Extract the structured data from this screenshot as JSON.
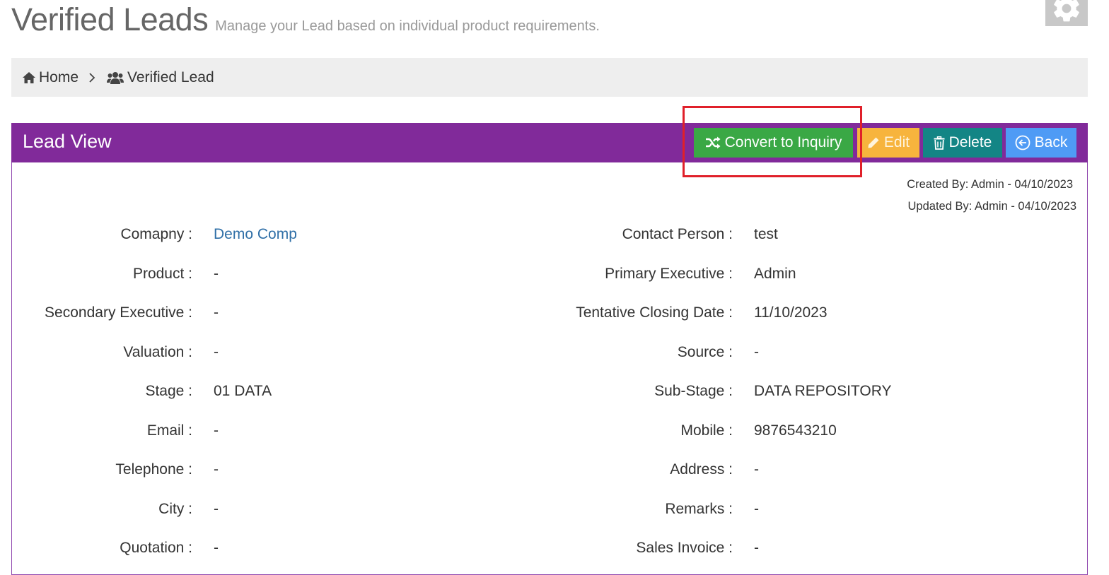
{
  "header": {
    "title": "Verified Leads",
    "subtitle": "Manage your Lead based on individual product requirements."
  },
  "settings": {
    "icon": "gear-icon"
  },
  "breadcrumb": {
    "home": {
      "label": "Home",
      "icon": "home-icon"
    },
    "separator_icon": "chevron-right-icon",
    "current": {
      "label": "Verified Lead",
      "icon": "users-icon"
    }
  },
  "panel": {
    "title": "Lead View",
    "accent_color": "#812a9a",
    "buttons": {
      "convert": {
        "label": "Convert to Inquiry",
        "icon": "shuffle-icon",
        "color": "#3aa845"
      },
      "edit": {
        "label": "Edit",
        "icon": "pencil-icon",
        "color": "#f7b43d"
      },
      "delete": {
        "label": "Delete",
        "icon": "trash-icon",
        "color": "#138585"
      },
      "back": {
        "label": "Back",
        "icon": "arrow-circle-left-icon",
        "color": "#4f9bf5"
      }
    },
    "created_by": "Created By: Admin - 04/10/2023",
    "updated_by": "Updated By: Admin - 04/10/2023"
  },
  "highlight_color": "#e0202a",
  "fields_left": [
    {
      "label": "Comapny :",
      "value": "Demo Comp",
      "link": true
    },
    {
      "label": "Product :",
      "value": "-"
    },
    {
      "label": "Secondary Executive :",
      "value": "-"
    },
    {
      "label": "Valuation :",
      "value": "-"
    },
    {
      "label": "Stage :",
      "value": "01 DATA"
    },
    {
      "label": "Email :",
      "value": "-"
    },
    {
      "label": "Telephone :",
      "value": "-"
    },
    {
      "label": "City :",
      "value": "-"
    },
    {
      "label": "Quotation :",
      "value": "-"
    }
  ],
  "fields_right": [
    {
      "label": "Contact Person :",
      "value": "test"
    },
    {
      "label": "Primary Executive :",
      "value": "Admin"
    },
    {
      "label": "Tentative Closing Date :",
      "value": "11/10/2023"
    },
    {
      "label": "Source :",
      "value": "-"
    },
    {
      "label": "Sub-Stage :",
      "value": "DATA REPOSITORY"
    },
    {
      "label": "Mobile :",
      "value": "9876543210"
    },
    {
      "label": "Address :",
      "value": "-"
    },
    {
      "label": "Remarks :",
      "value": "-"
    },
    {
      "label": "Sales Invoice :",
      "value": "-"
    }
  ]
}
